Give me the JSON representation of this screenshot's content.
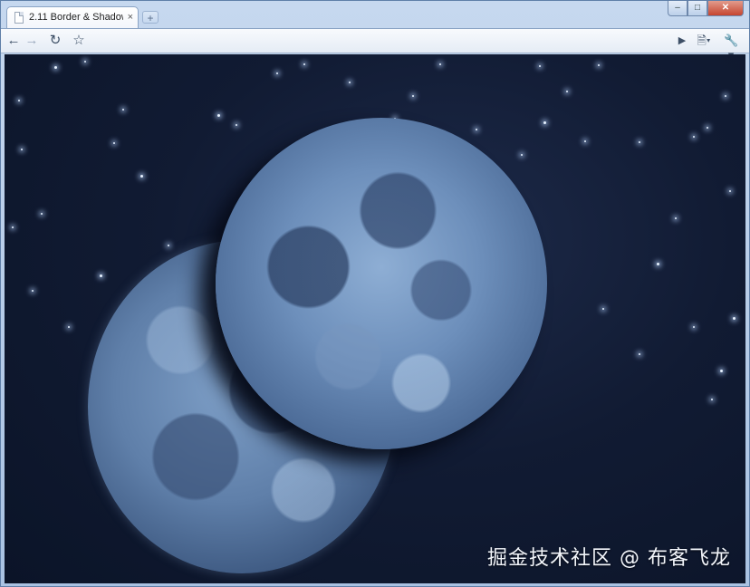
{
  "browser": {
    "tab_title": "2.11 Border & Shadow De...",
    "tab_close": "×",
    "new_tab": "+",
    "window_controls": {
      "minimize": "–",
      "maximize": "□",
      "close": "✕"
    },
    "toolbar": {
      "back_icon": "arrow-left-icon",
      "forward_icon": "arrow-right-icon",
      "reload_icon": "reload-icon",
      "bookmark_icon": "star-icon",
      "play_icon": "play-icon",
      "page_menu_icon": "page-menu-icon",
      "wrench_icon": "wrench-icon"
    },
    "accent_color": "#c6d8ef"
  },
  "page": {
    "background_color": "#111b33",
    "watermark": "掘金技术社区 @ 布客飞龙"
  }
}
